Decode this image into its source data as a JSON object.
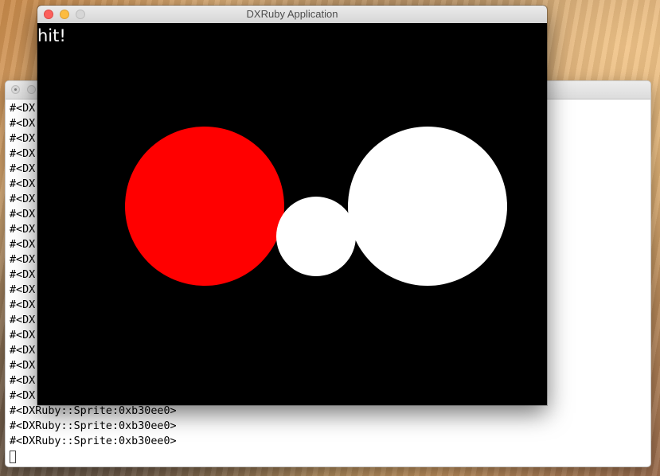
{
  "app_window": {
    "title": "DXRuby Application",
    "canvas_text": "hit!",
    "colors": {
      "hit_circle": "#ff0000",
      "circle": "#ffffff",
      "background": "#000000"
    }
  },
  "terminal": {
    "visible_prefix_lines": [
      "#<DX",
      "#<DX",
      "#<DX",
      "#<DX",
      "#<DX",
      "#<DX",
      "#<DX",
      "#<DX",
      "#<DX",
      "#<DX",
      "#<DX",
      "#<DX",
      "#<DX",
      "#<DX",
      "#<DX",
      "#<DX",
      "#<DX",
      "#<DX",
      "#<DX",
      "#<DX"
    ],
    "full_lines": [
      "#<DXRuby::Sprite:0xb30ee0>",
      "#<DXRuby::Sprite:0xb30ee0>",
      "#<DXRuby::Sprite:0xb30ee0>"
    ]
  }
}
